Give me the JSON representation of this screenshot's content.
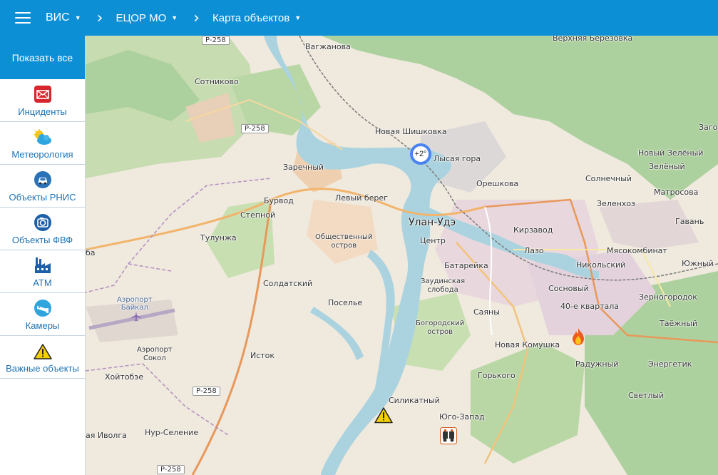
{
  "header": {
    "breadcrumbs": [
      {
        "label": "ВИС"
      },
      {
        "label": "ЕЦОР МО"
      },
      {
        "label": "Карта объектов"
      }
    ]
  },
  "sidebar": {
    "show_all": "Показать все",
    "items": [
      {
        "label": "Инциденты",
        "icon": "envelope-icon"
      },
      {
        "label": "Метеорология",
        "icon": "weather-cloud-icon"
      },
      {
        "label": "Объекты РНИС",
        "icon": "car-icon"
      },
      {
        "label": "Объекты ФВФ",
        "icon": "camera-lens-icon"
      },
      {
        "label": "АТМ",
        "icon": "factory-icon"
      },
      {
        "label": "Камеры",
        "icon": "cctv-icon"
      },
      {
        "label": "Важные объекты",
        "icon": "warning-icon"
      }
    ]
  },
  "map": {
    "meteo_marker": "+2°",
    "road_shields": [
      "Р-258",
      "Р-258",
      "Р-258",
      "Р-258"
    ],
    "places": {
      "vagzhanova": "Вагжанова",
      "verkhnyaya_berezovka": "Верхняя Березовка",
      "sotnikovo": "Сотниково",
      "zago": "Заго",
      "novaya_shishkovka": "Новая Шишковка",
      "lysaya_gora": "Лысая гора",
      "novy_zeleny": "Новый Зелёный",
      "zeleny": "Зелёный",
      "zarechny": "Заречный",
      "solnechny": "Солнечный",
      "oreshkova": "Орешкова",
      "matrosova": "Матросова",
      "burvod": "Бурвод",
      "levy_bereg": "Левый берег",
      "zelenkhoz": "Зеленхоз",
      "stepnoy": "Степной",
      "ulan_ude": "Улан-Удэ",
      "gavan": "Гавань",
      "tulunzha": "Тулунжа",
      "obshchestvenny_ostrov": "Общественный\nостров",
      "tsentr": "Центр",
      "kirzavod": "Кирзавод",
      "lazo": "Лазо",
      "myasokombinat": "Мясокомбинат",
      "ba": "ба",
      "yuzhny": "Южный",
      "batareyka": "Батарейка",
      "nikolsky": "Никольский",
      "soldatsky": "Солдатский",
      "zaudinskaya": "Заудинская\nслобода",
      "sosnovy": "Сосновый",
      "zernogorodok": "Зерногородок",
      "aeroport_baikal": "Аэропорт\nБайкал",
      "posele": "Поселье",
      "sayany": "Саяны",
      "kvartala_40": "40-е квартала",
      "bogorodsky": "Богородский\nостров",
      "tayozhny": "Таёжный",
      "istok": "Исток",
      "novaya_komushka": "Новая Комушка",
      "aeroport_sokol": "Аэропорт\nСокол",
      "raduzhny": "Радужный",
      "energetik": "Энергетик",
      "khoytobe": "Хойтобэе",
      "gorkogo": "Горького",
      "svetly": "Светлый",
      "silikatny": "Силикатный",
      "yugo_zapad": "Юго-Запад",
      "aya_ivolga": "ая Иволга",
      "nur_selenie": "Нур-Селение"
    }
  },
  "colors": {
    "header_bg": "#0d8fd6",
    "sidebar_label": "#1a72b4",
    "map_base": "#efe9de",
    "river": "#aad3df",
    "forest": "#add19e",
    "road_primary": "#f0a060",
    "meteo_ring": "#4b83f0"
  }
}
